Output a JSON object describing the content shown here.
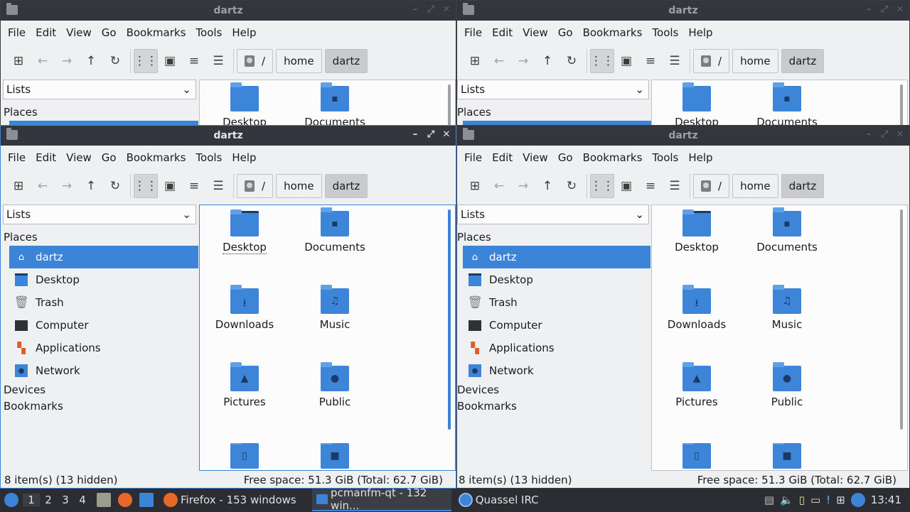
{
  "window_title": "dartz",
  "menu": [
    "File",
    "Edit",
    "View",
    "Go",
    "Bookmarks",
    "Tools",
    "Help"
  ],
  "breadcrumb": {
    "root": "/",
    "home": "home",
    "current": "dartz"
  },
  "side_combo": "Lists",
  "sidebar": {
    "places_label": "Places",
    "items": [
      "dartz",
      "Desktop",
      "Trash",
      "Computer",
      "Applications",
      "Network"
    ],
    "devices_label": "Devices",
    "bookmarks_label": "Bookmarks"
  },
  "files": [
    "Desktop",
    "Documents",
    "Downloads",
    "Music",
    "Pictures",
    "Public"
  ],
  "status": {
    "items": "8 item(s) (13 hidden)",
    "free": "Free space: 51.3 GiB (Total: 62.7 GiB)"
  },
  "taskbar": {
    "workspaces": [
      "1",
      "2",
      "3",
      "4"
    ],
    "firefox": "Firefox - 153 windows",
    "pcmanfm": "pcmanfm-qt - 132 win...",
    "quassel": "Quassel IRC",
    "clock": "13:41"
  },
  "colors": {
    "accent": "#3c84d8",
    "titlebar": "#33363d",
    "folder": "#3d85d8"
  }
}
